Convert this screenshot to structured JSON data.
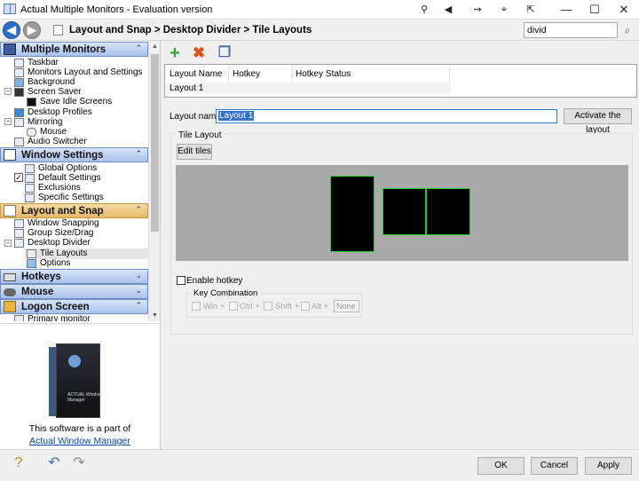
{
  "window": {
    "title": "Actual Multiple Monitors - Evaluation version",
    "title_icons": [
      "pin-icon",
      "volume-icon",
      "snap-icon",
      "target-icon",
      "window-move-icon"
    ],
    "controls": {
      "minimize": "—",
      "maximize": "☐",
      "close": "✕"
    }
  },
  "nav": {
    "breadcrumb": "Layout and Snap > Desktop Divider > Tile Layouts",
    "search_value": "divid"
  },
  "sidebar": {
    "groups": {
      "multiple_monitors": {
        "label": "Multiple Monitors",
        "chevron": "⌃"
      },
      "window_settings": {
        "label": "Window Settings",
        "chevron": "⌃"
      },
      "layout_and_snap": {
        "label": "Layout and Snap",
        "chevron": "⌃"
      },
      "hotkeys": {
        "label": "Hotkeys",
        "chevron": "⌄"
      },
      "mouse": {
        "label": "Mouse",
        "chevron": "⌄"
      },
      "logon_screen": {
        "label": "Logon Screen",
        "chevron": "⌃"
      }
    },
    "items": {
      "taskbar": "Taskbar",
      "monitors_layout": "Monitors Layout and Settings",
      "background": "Background",
      "screen_saver": "Screen Saver",
      "save_idle_screens": "Save Idle Screens",
      "desktop_profiles": "Desktop Profiles",
      "mirroring": "Mirroring",
      "mirror_mouse": "Mouse",
      "audio_switcher": "Audio Switcher",
      "global_options": "Global Options",
      "default_settings": "Default Settings",
      "exclusions": "Exclusions",
      "specific_settings": "Specific Settings",
      "window_snapping": "Window Snapping",
      "group_size_drag": "Group Size/Drag",
      "desktop_divider": "Desktop Divider",
      "tile_layouts": "Tile Layouts",
      "options": "Options",
      "primary_monitor": "Primary monitor"
    },
    "promo": {
      "box_text": "ACTUAL Window Manager",
      "text": "This software is a part of",
      "link": "Actual Window Manager"
    }
  },
  "toolbar": {
    "add": "+",
    "remove": "✖",
    "copy": "❐"
  },
  "grid": {
    "columns": [
      "Layout Name",
      "Hotkey",
      "Hotkey Status"
    ],
    "rows": [
      [
        "Layout 1",
        "",
        ""
      ]
    ]
  },
  "form": {
    "layout_name_label": "Layout name:",
    "layout_name_value": "Layout 1",
    "activate_button": "Activate the layout",
    "tile_layout_legend": "Tile Layout",
    "edit_tiles_button": "Edit tiles",
    "enable_hotkey_label": "Enable hotkey",
    "key_combination_legend": "Key Combination",
    "win": "Win +",
    "ctrl": "Ctrl +",
    "shift": "Shift +",
    "alt": "Alt +",
    "key_value": "None"
  },
  "footer": {
    "ok": "OK",
    "cancel": "Cancel",
    "apply": "Apply"
  },
  "colors": {
    "accent": "#2a6fc9",
    "group_header": "#a8c1ec",
    "active_group": "#e6b865",
    "tile_border": "#21d021",
    "preview_bg": "#a9a9a9"
  }
}
